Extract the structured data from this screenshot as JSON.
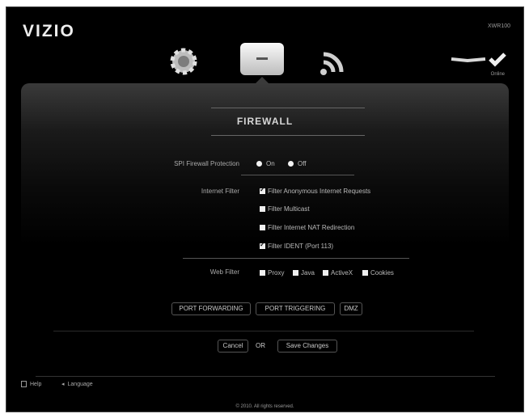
{
  "header": {
    "brand": "VIZIO",
    "model": "XWR100"
  },
  "nav": {
    "icons": [
      "gear-icon",
      "router-icon",
      "wifi-icon"
    ]
  },
  "status": {
    "label": "Online"
  },
  "page": {
    "title": "FIREWALL"
  },
  "spi": {
    "label": "SPI Firewall Protection",
    "options": [
      "On",
      "Off"
    ],
    "selected": "Off"
  },
  "internet_filter": {
    "label": "Internet Filter",
    "options": [
      {
        "label": "Filter Anonymous Internet Requests",
        "checked": true
      },
      {
        "label": "Filter Multicast",
        "checked": false
      },
      {
        "label": "Filter Internet NAT Redirection",
        "checked": false
      },
      {
        "label": "Filter IDENT (Port 113)",
        "checked": true
      }
    ]
  },
  "web_filter": {
    "label": "Web Filter",
    "options": [
      {
        "label": "Proxy",
        "checked": false
      },
      {
        "label": "Java",
        "checked": false
      },
      {
        "label": "ActiveX",
        "checked": false
      },
      {
        "label": "Cookies",
        "checked": false
      }
    ]
  },
  "links": {
    "port_forwarding": "PORT FORWARDING",
    "port_triggering": "PORT TRIGGERING",
    "dmz": "DMZ"
  },
  "actions": {
    "cancel": "Cancel",
    "or": "OR",
    "save": "Save Changes"
  },
  "footer": {
    "help": "Help",
    "language": "Language",
    "copyright": "© 2010. All rights reserved."
  },
  "colors": {
    "background": "#000000",
    "text": "#aaaaaa",
    "accent": "#f3f3f3"
  }
}
